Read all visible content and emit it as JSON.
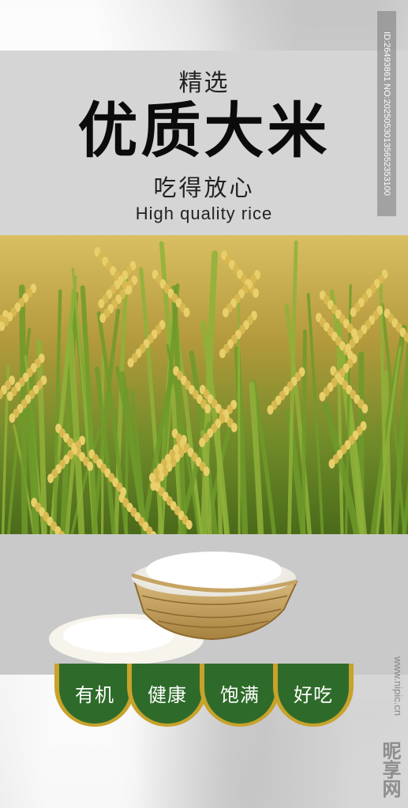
{
  "header": {
    "subtitle_top": "精选",
    "main_title": "优质大米",
    "slogan": "吃得放心",
    "english": "High quality rice"
  },
  "features": [
    {
      "label": "有机",
      "icon": "badge-organic"
    },
    {
      "label": "健康",
      "icon": "badge-healthy"
    },
    {
      "label": "饱满",
      "icon": "badge-plump"
    },
    {
      "label": "好吃",
      "icon": "badge-tasty"
    }
  ],
  "watermark": {
    "id_text": "ID:26493861 NO:20250530135652353100",
    "site": "www.nipic.cn",
    "logo": "昵享网"
  },
  "colors": {
    "badge_green": "#2e6b2a",
    "badge_gold": "#c8a22b",
    "header_panel": "#d5d5d5",
    "title_text": "#0b0b0b"
  },
  "images": {
    "field": "rice-field-photo",
    "bowl": "bamboo-basket-with-rice"
  }
}
